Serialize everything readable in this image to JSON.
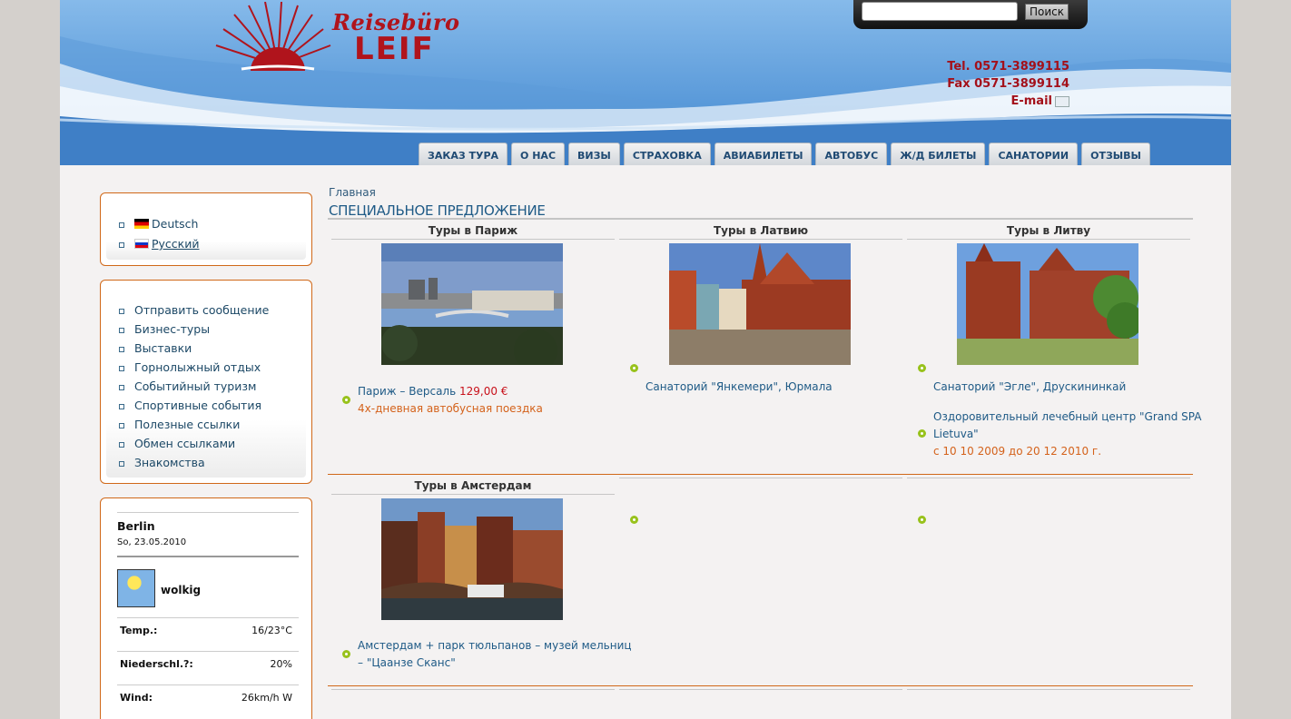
{
  "brand": {
    "script": "Reisebüro",
    "name": "LEIF"
  },
  "search": {
    "value": "",
    "button_label": "Поиск"
  },
  "contacts": {
    "tel": "Tel. 0571-3899115",
    "fax": "Fax 0571-3899114",
    "email": "E-mail"
  },
  "nav": [
    "ЗАКАЗ ТУРА",
    "О НАС",
    "ВИЗЫ",
    "СТРАХОВКА",
    "АВИАБИЛЕТЫ",
    "АВТОБУС",
    "Ж/Д БИЛЕТЫ",
    "САНАТОРИИ",
    "ОТЗЫВЫ"
  ],
  "languages": [
    {
      "label": "Deutsch",
      "flag": "de-flag-icon"
    },
    {
      "label": "Русский",
      "flag": "ru-flag-icon",
      "active": true
    }
  ],
  "sidebar_menu": [
    "Отправить сообщение",
    "Бизнес-туры",
    "Выставки",
    "Горнолыжный отдых",
    "Событийный туризм",
    "Спортивные события",
    "Полезные ссылки",
    "Обмен ссылками",
    "Знакомства"
  ],
  "weather": {
    "city": "Berlin",
    "date": "So, 23.05.2010",
    "condition": "wolkig",
    "icon": "partly-cloudy-icon",
    "rows": [
      {
        "label": "Temp.:",
        "value": "16/23°C"
      },
      {
        "label": "Niederschl.?:",
        "value": "20%"
      },
      {
        "label": "Wind:",
        "value": "26km/h W"
      }
    ]
  },
  "breadcrumb": "Главная",
  "page_title": "СПЕЦИАЛЬНОЕ ПРЕДЛОЖЕНИЕ",
  "offers": [
    {
      "title": "Туры в Париж",
      "image": "paris-photo",
      "lines": [
        {
          "text": "Париж – Версаль ",
          "price": "129,00 €"
        },
        {
          "sub": "4х-дневная автобусная поездка"
        }
      ]
    },
    {
      "title": "Туры в Латвию",
      "image": "riga-photo",
      "lines": [
        {
          "text": "Санаторий \"Янкемери\", Юрмала"
        }
      ]
    },
    {
      "title": "Туры в Литву",
      "image": "vilnius-photo",
      "lines": [
        {
          "text": "Санаторий \"Эгле\", Друскининкай"
        },
        {
          "text": "Оздоровительный лечебный центр \"Grand SPA",
          "text2": "Lietuva\"",
          "sub": "с 10 10 2009 до 20 12 2010 г."
        }
      ]
    },
    {
      "title": "Туры в Амстердам",
      "image": "amsterdam-photo",
      "lines": [
        {
          "text": "Амстердам + парк тюльпанов – музей мельниц",
          "text2": "– \"Цаанзе Сканс\""
        }
      ]
    }
  ],
  "colors": {
    "accent_orange": "#d06818",
    "link_blue": "#1e5a86",
    "brand_red": "#b0141c",
    "bullet_green": "#98c21c"
  }
}
